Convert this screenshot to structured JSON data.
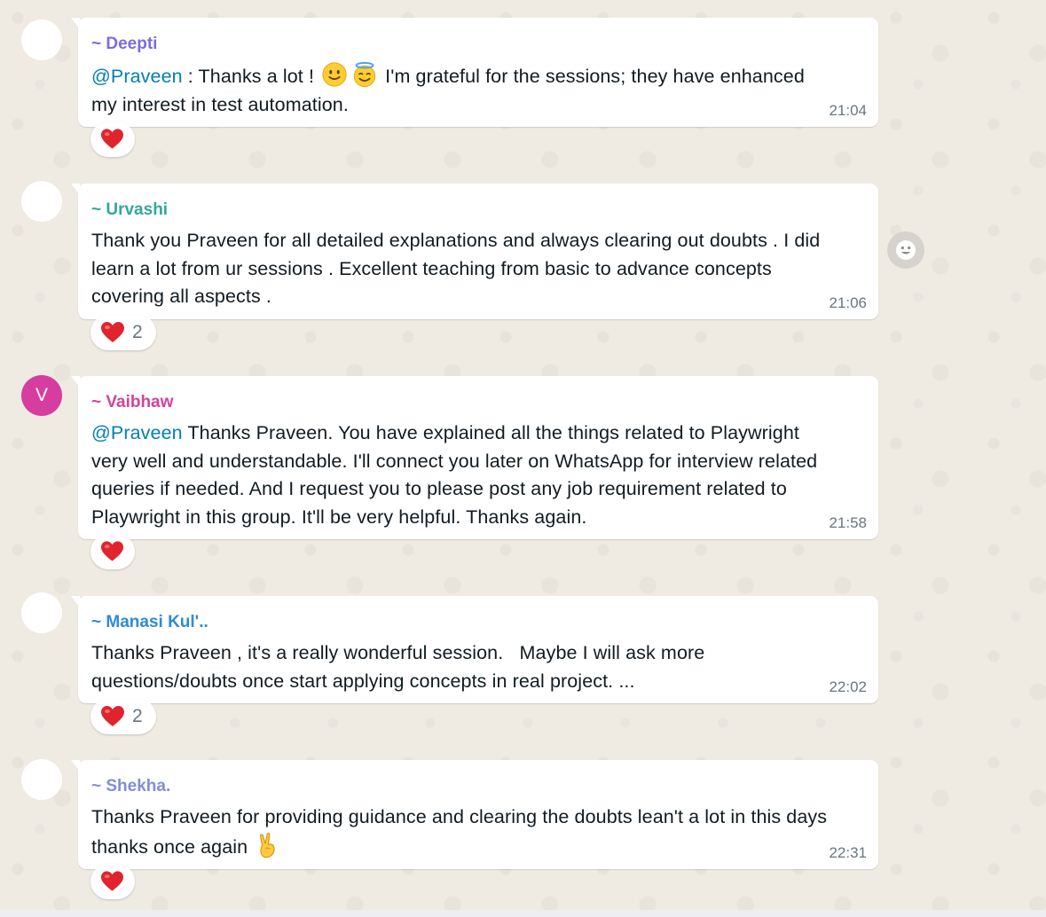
{
  "messages": [
    {
      "sender": "~ Deepti",
      "sender_color": "#7b6ce0",
      "mention": "@Praveen",
      "text_a": " : Thanks a lot ! ",
      "emojis": [
        "slightly-smiling-face",
        "smiling-face-with-halo"
      ],
      "text_b": " I'm grateful for the sessions; they have enhanced my interest in test automation.",
      "time": "21:04",
      "reaction": "heart",
      "reaction_count": ""
    },
    {
      "sender": "~ Urvashi",
      "sender_color": "#35a69a",
      "text": "Thank you Praveen for all detailed explanations and always clearing out doubts . I did learn a lot from ur sessions . Excellent teaching from basic to advance concepts covering all aspects .",
      "time": "21:06",
      "reaction": "heart",
      "reaction_count": "2"
    },
    {
      "avatar_initial": "V",
      "avatar_color": "#d63d9f",
      "sender": "~ Vaibhaw",
      "sender_color": "#d0449a",
      "mention": "@Praveen",
      "text": " Thanks Praveen. You have explained all the things related to Playwright very well and understandable. I'll connect you later on WhatsApp for interview related queries if needed. And I request you to please post any job requirement related to Playwright in this group. It'll be very helpful. Thanks again.",
      "time": "21:58",
      "reaction": "heart",
      "reaction_count": ""
    },
    {
      "sender": "~ Manasi Kul'..",
      "sender_color": "#2f8ad8",
      "text": "Thanks Praveen , it's a really wonderful session.   Maybe I will ask more questions/doubts once start applying concepts in real project. ...",
      "time": "22:02",
      "reaction": "heart",
      "reaction_count": "2"
    },
    {
      "sender": "~ Shekha.",
      "sender_color": "#7f8fd6",
      "text": "Thanks Praveen for providing guidance and clearing the doubts lean't a lot in this days thanks once again ",
      "emoji": "victory-hand",
      "time": "22:31",
      "reaction": "heart",
      "reaction_count": ""
    }
  ],
  "icons": {
    "react_button": "smiley-icon",
    "reaction": "red-heart-icon"
  }
}
